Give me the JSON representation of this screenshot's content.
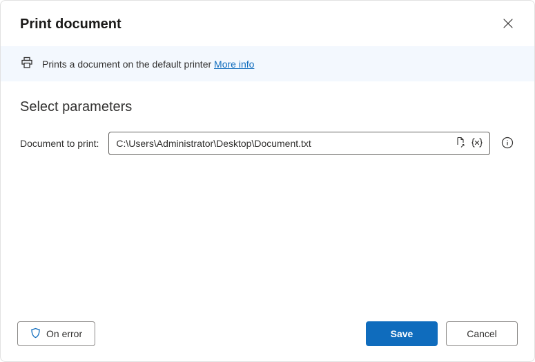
{
  "header": {
    "title": "Print document"
  },
  "info": {
    "description": "Prints a document on the default printer ",
    "link_text": "More info"
  },
  "parameters": {
    "section_title": "Select parameters",
    "doc_label": "Document to print:",
    "doc_value": "C:\\Users\\Administrator\\Desktop\\Document.txt"
  },
  "footer": {
    "on_error": "On error",
    "save": "Save",
    "cancel": "Cancel"
  }
}
